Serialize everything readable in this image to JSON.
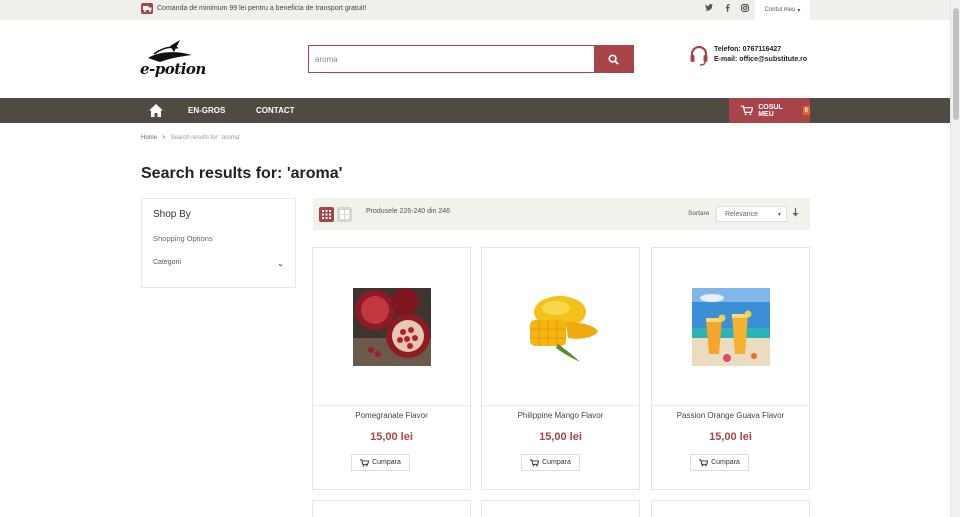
{
  "topbar": {
    "notice": "Comanda de minimum 99 lei pentru a beneficia de transport gratuit!",
    "social": [
      "twitter-icon",
      "facebook-icon",
      "instagram-icon"
    ],
    "account": "Contul meu"
  },
  "header": {
    "logo_text": "e-potion",
    "search": {
      "value": "aroma",
      "placeholder": ""
    },
    "contact": {
      "phone_label": "Telefon:",
      "phone": "0767116427",
      "email_label": "E-mail:",
      "email": "office@substitute.ro"
    }
  },
  "nav": {
    "items": [
      "EN-GROS",
      "CONTACT"
    ],
    "cart_label": "COSUL MEU",
    "cart_count": "0"
  },
  "breadcrumb": {
    "home": "Home",
    "separator": ">",
    "current": "Search results for: 'aroma'"
  },
  "page_title": "Search results for: 'aroma'",
  "sidebar": {
    "title": "Shop By",
    "subtitle": "Shopping Options",
    "filter": "Categorii"
  },
  "toolbar": {
    "amount": "Produsele 226-240 din 246",
    "sort_label": "Sortare",
    "sort_value": "Relevance"
  },
  "products": [
    {
      "name": "Pomegranate Flavor",
      "price": "15,00 lei",
      "button": "Cumpara"
    },
    {
      "name": "Philippine Mango Flavor",
      "price": "15,00 lei",
      "button": "Cumpara"
    },
    {
      "name": "Passion Orange Guava Flavor",
      "price": "15,00 lei",
      "button": "Cumpara"
    }
  ],
  "colors": {
    "accent": "#a94448",
    "nav_bg": "#4f4a42",
    "topbar_bg": "#f1efea",
    "cart_badge": "#e06b24"
  }
}
